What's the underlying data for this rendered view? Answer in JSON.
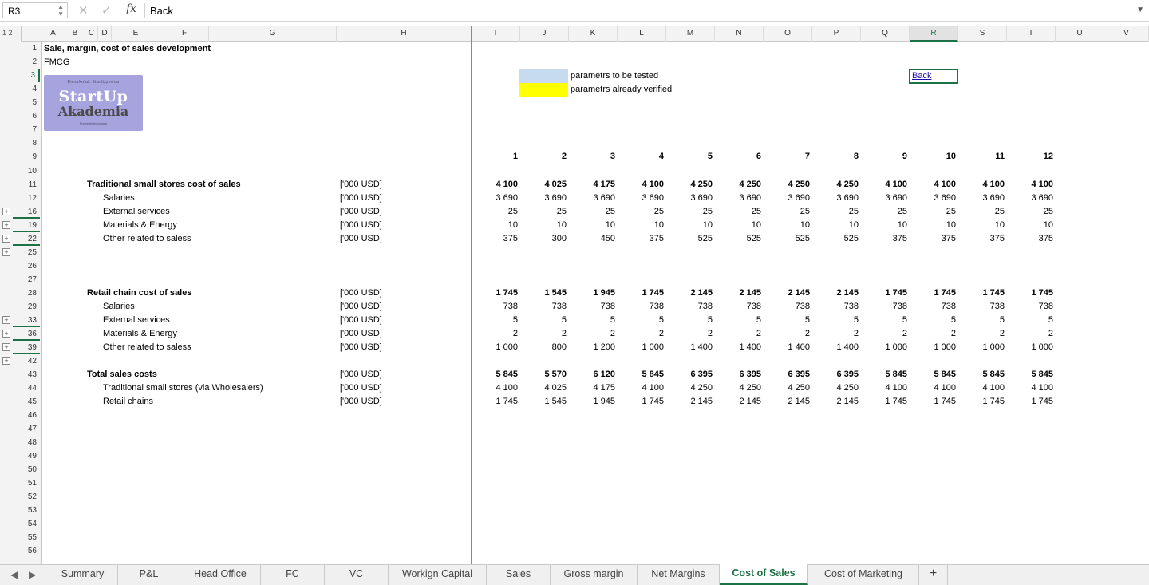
{
  "formula_bar": {
    "cell_ref": "R3",
    "cancel_icon": "close-icon",
    "confirm_icon": "check-icon",
    "fx_label": "fx",
    "value": "Back"
  },
  "outline_levels": "1 2",
  "columns": [
    "A",
    "B",
    "C",
    "D",
    "E",
    "F",
    "G",
    "H",
    "I",
    "J",
    "K",
    "L",
    "M",
    "N",
    "O",
    "P",
    "Q",
    "R",
    "S",
    "T",
    "U",
    "V"
  ],
  "selected_column": "R",
  "rows": [
    "1",
    "2",
    "3",
    "4",
    "5",
    "6",
    "7",
    "8",
    "9",
    "10",
    "11",
    "12",
    "16",
    "19",
    "22",
    "25",
    "26",
    "27",
    "28",
    "29",
    "33",
    "36",
    "39",
    "42",
    "43",
    "44",
    "45",
    "46",
    "47",
    "48",
    "49",
    "50",
    "51",
    "52",
    "53",
    "54",
    "55",
    "56"
  ],
  "header": {
    "title": "Sale, margin, cost of sales development",
    "subtitle": "FMCG"
  },
  "logo": {
    "top_text": "Bieszkoluk StartUpowca",
    "line1": "StartUp",
    "line2": "Akademia",
    "bottom_text": "Przedsiebiorcowski"
  },
  "legend": {
    "blue_label": "parametrs to be tested",
    "yellow_label": "parametrs already verified",
    "blue_color": "#c6dbef",
    "yellow_color": "#ffff00"
  },
  "back_link": "Back",
  "period_headers": [
    "1",
    "2",
    "3",
    "4",
    "5",
    "6",
    "7",
    "8",
    "9",
    "10",
    "11",
    "12"
  ],
  "unit": "['000 USD]",
  "sections": [
    {
      "rows": [
        {
          "label": "Traditional small stores cost of sales",
          "bold": true,
          "values": [
            "4 100",
            "4 025",
            "4 175",
            "4 100",
            "4 250",
            "4 250",
            "4 250",
            "4 250",
            "4 100",
            "4 100",
            "4 100",
            "4 100"
          ]
        },
        {
          "label": "Salaries",
          "bold": false,
          "values": [
            "3 690",
            "3 690",
            "3 690",
            "3 690",
            "3 690",
            "3 690",
            "3 690",
            "3 690",
            "3 690",
            "3 690",
            "3 690",
            "3 690"
          ]
        },
        {
          "label": "External services",
          "bold": false,
          "values": [
            "25",
            "25",
            "25",
            "25",
            "25",
            "25",
            "25",
            "25",
            "25",
            "25",
            "25",
            "25"
          ]
        },
        {
          "label": "Materials & Energy",
          "bold": false,
          "values": [
            "10",
            "10",
            "10",
            "10",
            "10",
            "10",
            "10",
            "10",
            "10",
            "10",
            "10",
            "10"
          ]
        },
        {
          "label": "Other related to saless",
          "bold": false,
          "values": [
            "375",
            "300",
            "450",
            "375",
            "525",
            "525",
            "525",
            "525",
            "375",
            "375",
            "375",
            "375"
          ]
        }
      ]
    },
    {
      "rows": [
        {
          "label": "Retail chain cost of sales",
          "bold": true,
          "values": [
            "1 745",
            "1 545",
            "1 945",
            "1 745",
            "2 145",
            "2 145",
            "2 145",
            "2 145",
            "1 745",
            "1 745",
            "1 745",
            "1 745"
          ]
        },
        {
          "label": "Salaries",
          "bold": false,
          "values": [
            "738",
            "738",
            "738",
            "738",
            "738",
            "738",
            "738",
            "738",
            "738",
            "738",
            "738",
            "738"
          ]
        },
        {
          "label": "External services",
          "bold": false,
          "values": [
            "5",
            "5",
            "5",
            "5",
            "5",
            "5",
            "5",
            "5",
            "5",
            "5",
            "5",
            "5"
          ]
        },
        {
          "label": "Materials & Energy",
          "bold": false,
          "values": [
            "2",
            "2",
            "2",
            "2",
            "2",
            "2",
            "2",
            "2",
            "2",
            "2",
            "2",
            "2"
          ]
        },
        {
          "label": "Other related to saless",
          "bold": false,
          "values": [
            "1 000",
            "800",
            "1 200",
            "1 000",
            "1 400",
            "1 400",
            "1 400",
            "1 400",
            "1 000",
            "1 000",
            "1 000",
            "1 000"
          ]
        }
      ]
    },
    {
      "rows": [
        {
          "label": "Total sales costs",
          "bold": true,
          "values": [
            "5 845",
            "5 570",
            "6 120",
            "5 845",
            "6 395",
            "6 395",
            "6 395",
            "6 395",
            "5 845",
            "5 845",
            "5 845",
            "5 845"
          ]
        },
        {
          "label": "Traditional small stores (via Wholesalers)",
          "bold": false,
          "values": [
            "4 100",
            "4 025",
            "4 175",
            "4 100",
            "4 250",
            "4 250",
            "4 250",
            "4 250",
            "4 100",
            "4 100",
            "4 100",
            "4 100"
          ]
        },
        {
          "label": "Retail chains",
          "bold": false,
          "values": [
            "1 745",
            "1 545",
            "1 945",
            "1 745",
            "2 145",
            "2 145",
            "2 145",
            "2 145",
            "1 745",
            "1 745",
            "1 745",
            "1 745"
          ]
        }
      ]
    }
  ],
  "tabs": [
    "Summary",
    "P&L",
    "Head Office",
    "FC",
    "VC",
    "Workign Capital",
    "Sales",
    "Gross margin",
    "Net Margins",
    "Cost of Sales",
    "Cost of Marketing"
  ],
  "active_tab": "Cost of Sales",
  "add_tab": "+",
  "nav_prev": "◀",
  "nav_next": "▶"
}
